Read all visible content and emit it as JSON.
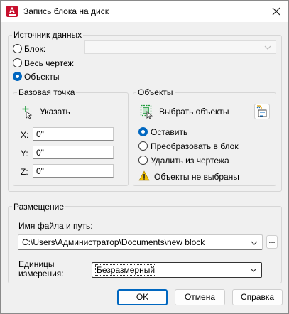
{
  "window": {
    "title": "Запись блока на диск",
    "app_icon_letter": "A"
  },
  "source": {
    "group_label": "Источник данных",
    "block_label": "Блок:",
    "whole_drawing_label": "Весь чертеж",
    "objects_label": "Объекты",
    "selected": "objects"
  },
  "base_point": {
    "group_label": "Базовая точка",
    "pick_label": "Указать",
    "x_label": "X:",
    "x_value": "0\"",
    "y_label": "Y:",
    "y_value": "0\"",
    "z_label": "Z:",
    "z_value": "0\""
  },
  "objects": {
    "group_label": "Объекты",
    "select_label": "Выбрать объекты",
    "retain_label": "Оставить",
    "convert_label": "Преобразовать в блок",
    "delete_label": "Удалить из чертежа",
    "selected": "retain",
    "status": "Объекты не выбраны"
  },
  "destination": {
    "group_label": "Размещение",
    "path_label": "Имя файла и путь:",
    "path_value": "C:\\Users\\Администратор\\Documents\\new block",
    "browse_label": "...",
    "units_label_1": "Единицы",
    "units_label_2": "измерения:",
    "units_value": "Безразмерный"
  },
  "buttons": {
    "ok": "OK",
    "cancel": "Отмена",
    "help": "Справка"
  },
  "colors": {
    "accent": "#0067c0",
    "brand": "#c8102e",
    "warning": "#f2c200"
  },
  "icons": [
    "app-icon",
    "close-icon",
    "pick-point-icon",
    "select-objects-icon",
    "quick-select-icon",
    "warning-icon",
    "chevron-down-icon"
  ]
}
